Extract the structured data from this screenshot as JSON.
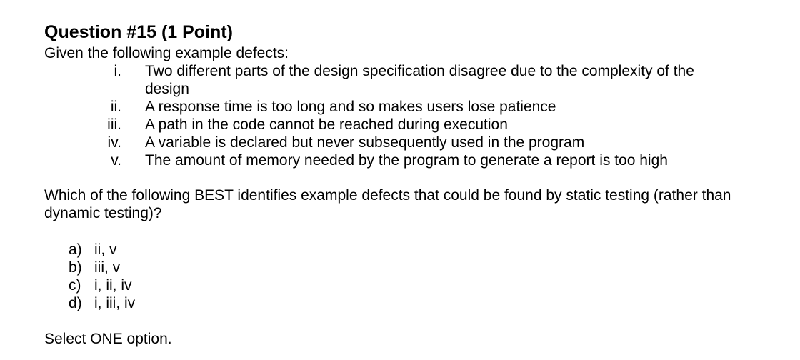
{
  "question": {
    "title": "Question #15 (1 Point)",
    "intro": "Given the following example defects:",
    "defects": [
      {
        "numeral": "i.",
        "text": "Two different parts of the design specification disagree due to the complexity of the design"
      },
      {
        "numeral": "ii.",
        "text": "A response time is too long and so makes users lose patience"
      },
      {
        "numeral": "iii.",
        "text": "A path in the code cannot be reached during execution"
      },
      {
        "numeral": "iv.",
        "text": "A variable is declared but never subsequently used in the program"
      },
      {
        "numeral": "v.",
        "text": "The amount of memory needed by the program to generate a report is too high"
      }
    ],
    "prompt": "Which of the following BEST identifies example defects that could be found by static testing (rather than dynamic testing)?",
    "options": [
      {
        "letter": "a)",
        "value": "ii, v"
      },
      {
        "letter": "b)",
        "value": "iii, v"
      },
      {
        "letter": "c)",
        "value": "i, ii, iv"
      },
      {
        "letter": "d)",
        "value": "i, iii, iv"
      }
    ],
    "instruction": "Select ONE option."
  }
}
